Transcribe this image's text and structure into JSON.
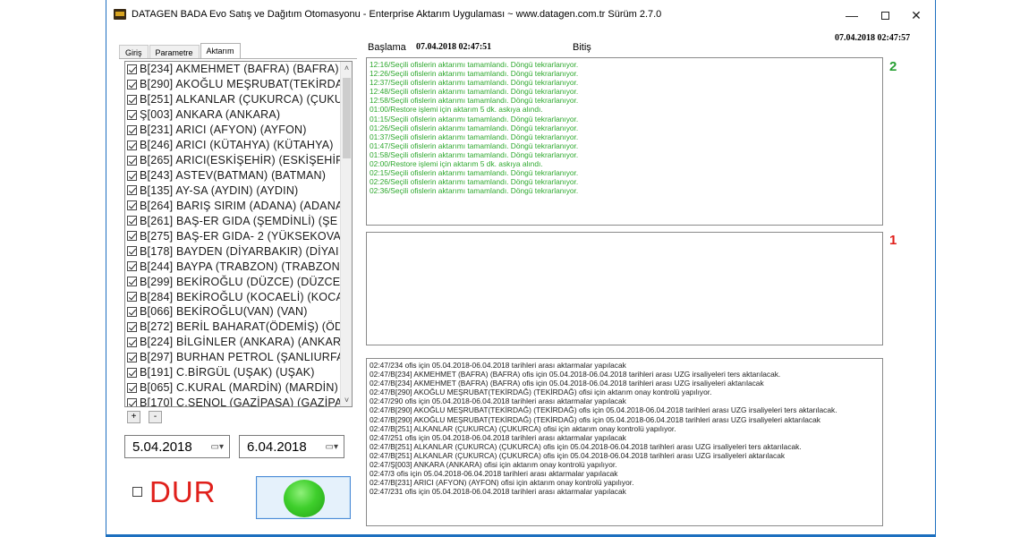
{
  "window": {
    "title": "DATAGEN BADA  Evo Satış ve Dağıtım Otomasyonu - Enterprise Aktarım Uygulaması ~ www.datagen.com.tr Sürüm 2.7.0",
    "minimize": "—",
    "close": "✕"
  },
  "tabs": [
    {
      "label": "Giriş"
    },
    {
      "label": "Parametre"
    },
    {
      "label": "Aktarım"
    }
  ],
  "offices": [
    {
      "label": "B[234] AKMEHMET (BAFRA) (BAFRA)",
      "checked": true
    },
    {
      "label": "B[290] AKOĞLU MEŞRUBAT(TEKİRDA",
      "checked": true
    },
    {
      "label": "B[251] ALKANLAR (ÇUKURCA) (ÇUKU",
      "checked": true
    },
    {
      "label": "Ş[003] ANKARA (ANKARA)",
      "checked": true
    },
    {
      "label": "B[231] ARICI (AFYON) (AYFON)",
      "checked": true
    },
    {
      "label": "B[246] ARICI (KÜTAHYA) (KÜTAHYA)",
      "checked": true
    },
    {
      "label": "B[265] ARICI(ESKİŞEHİR) (ESKİŞEHİR",
      "checked": true
    },
    {
      "label": "B[243] ASTEV(BATMAN) (BATMAN)",
      "checked": true
    },
    {
      "label": "B[135] AY-SA (AYDIN) (AYDIN)",
      "checked": true
    },
    {
      "label": "B[264] BARIŞ SIRIM (ADANA) (ADANA",
      "checked": true
    },
    {
      "label": "B[261] BAŞ-ER GIDA  (ŞEMDİNLİ) (ŞE",
      "checked": true
    },
    {
      "label": "B[275] BAŞ-ER GIDA- 2 (YÜKSEKOVA",
      "checked": true
    },
    {
      "label": "B[178] BAYDEN (DİYARBAKIR) (DİYAI",
      "checked": true
    },
    {
      "label": "B[244] BAYPA (TRABZON) (TRABZON)",
      "checked": true
    },
    {
      "label": "B[299] BEKİROĞLU (DÜZCE) (DÜZCE",
      "checked": true
    },
    {
      "label": "B[284] BEKİROĞLU (KOCAELİ) (KOCA",
      "checked": true
    },
    {
      "label": "B[066] BEKİROĞLU(VAN) (VAN)",
      "checked": true
    },
    {
      "label": "B[272] BERİL BAHARAT(ÖDEMİŞ) (ÖD",
      "checked": true
    },
    {
      "label": "B[224] BİLGİNLER (ANKARA) (ANKAR",
      "checked": true
    },
    {
      "label": "B[297] BURHAN PETROL (ŞANLIURFA",
      "checked": true
    },
    {
      "label": "B[191] C.BİRGÜL (UŞAK) (UŞAK)",
      "checked": true
    },
    {
      "label": "B[065] C.KURAL  (MARDİN) (MARDİN)",
      "checked": true
    },
    {
      "label": "B[170] C.ŞENOL (GAZİPAŞA) (GAZİPA",
      "checked": true
    }
  ],
  "list_buttons": {
    "add": "+",
    "remove": "-"
  },
  "dates": {
    "start": "5.04.2018",
    "end": "6.04.2018"
  },
  "controls": {
    "dur_label": "DUR",
    "dur_checked": false
  },
  "header": {
    "start_label": "Başlama",
    "start_value": "07.04.2018 02:47:51",
    "end_label": "Bitiş",
    "top_right_value": "07.04.2018 02:47:57"
  },
  "markers": {
    "log_top": "2",
    "log_middle": "1"
  },
  "log_top": [
    "12:16/Seçili ofislerin aktarımı tamamlandı. Döngü tekrarlanıyor.",
    "12:26/Seçili ofislerin aktarımı tamamlandı. Döngü tekrarlanıyor.",
    "12:37/Seçili ofislerin aktarımı tamamlandı. Döngü tekrarlanıyor.",
    "12:48/Seçili ofislerin aktarımı tamamlandı. Döngü tekrarlanıyor.",
    "12:58/Seçili ofislerin aktarımı tamamlandı. Döngü tekrarlanıyor.",
    "01:00/Restore işlemi için aktarım 5 dk. askıya alındı.",
    "01:15/Seçili ofislerin aktarımı tamamlandı. Döngü tekrarlanıyor.",
    "01:26/Seçili ofislerin aktarımı tamamlandı. Döngü tekrarlanıyor.",
    "01:37/Seçili ofislerin aktarımı tamamlandı. Döngü tekrarlanıyor.",
    "01:47/Seçili ofislerin aktarımı tamamlandı. Döngü tekrarlanıyor.",
    "01:58/Seçili ofislerin aktarımı tamamlandı. Döngü tekrarlanıyor.",
    "02:00/Restore işlemi için aktarım 5 dk. askıya alındı.",
    "02:15/Seçili ofislerin aktarımı tamamlandı. Döngü tekrarlanıyor.",
    "02:26/Seçili ofislerin aktarımı tamamlandı. Döngü tekrarlanıyor.",
    "02:36/Seçili ofislerin aktarımı tamamlandı. Döngü tekrarlanıyor."
  ],
  "log_bottom": [
    "02:47/234 ofis için 05.04.2018-06.04.2018 tarihleri arası aktarmalar yapılacak",
    "02:47/B[234] AKMEHMET (BAFRA) (BAFRA) ofis için 05.04.2018-06.04.2018 tarihleri arası UZG irsaliyeleri ters aktarılacak.",
    "02:47/B[234] AKMEHMET (BAFRA) (BAFRA) ofis için 05.04.2018-06.04.2018 tarihleri arası UZG irsaliyeleri aktarılacak",
    "02:47/B[290] AKOĞLU MEŞRUBAT(TEKİRDAĞ) (TEKİRDAĞ) ofisi için aktarım onay kontrolü yapılıyor.",
    "02:47/290 ofis için 05.04.2018-06.04.2018 tarihleri arası aktarmalar yapılacak",
    "02:47/B[290] AKOĞLU MEŞRUBAT(TEKİRDAĞ) (TEKİRDAĞ) ofis için 05.04.2018-06.04.2018 tarihleri arası UZG irsaliyeleri ters aktarılacak.",
    "02:47/B[290] AKOĞLU MEŞRUBAT(TEKİRDAĞ) (TEKİRDAĞ) ofis için 05.04.2018-06.04.2018 tarihleri arası UZG irsaliyeleri aktarılacak",
    "02:47/B[251] ALKANLAR (ÇUKURCA) (ÇUKURCA) ofisi için aktarım onay kontrolü yapılıyor.",
    "02:47/251 ofis için 05.04.2018-06.04.2018 tarihleri arası aktarmalar yapılacak",
    "02:47/B[251] ALKANLAR (ÇUKURCA) (ÇUKURCA) ofis için 05.04.2018-06.04.2018 tarihleri arası UZG irsaliyeleri ters aktarılacak.",
    "02:47/B[251] ALKANLAR (ÇUKURCA) (ÇUKURCA) ofis için 05.04.2018-06.04.2018 tarihleri arası UZG irsaliyeleri aktarılacak",
    "02:47/Ş[003] ANKARA (ANKARA) ofisi için aktarım onay kontrolü yapılıyor.",
    "02:47/3 ofis için 05.04.2018-06.04.2018 tarihleri arası aktarmalar yapılacak",
    "02:47/B[231] ARICI (AFYON) (AYFON) ofisi için aktarım onay kontrolü yapılıyor.",
    "02:47/231 ofis için 05.04.2018-06.04.2018 tarihleri arası aktarmalar yapılacak"
  ]
}
